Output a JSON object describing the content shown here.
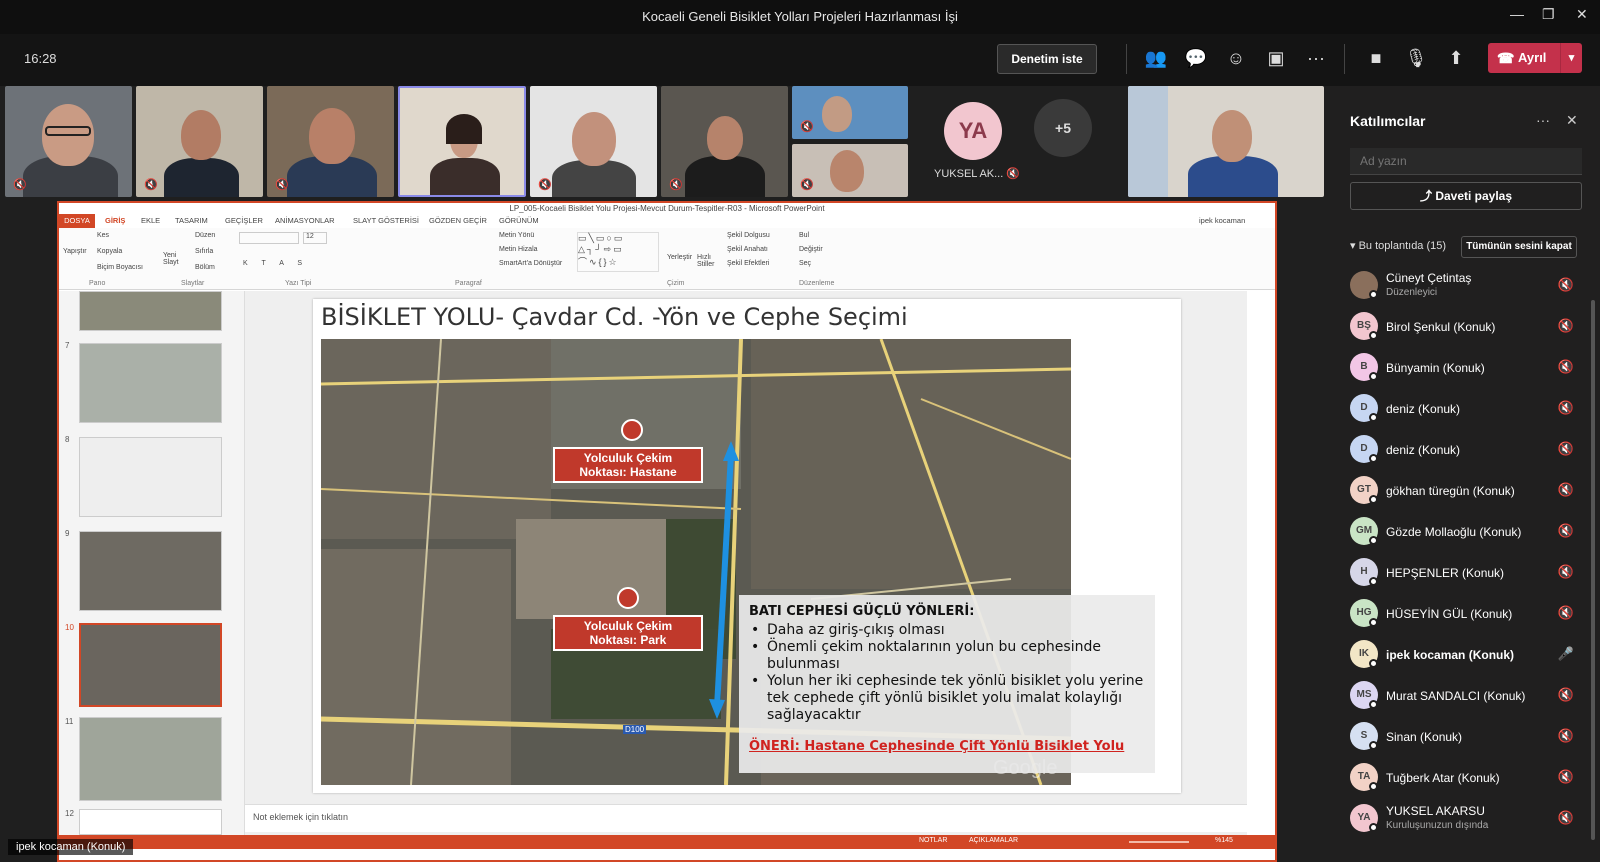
{
  "window": {
    "title": "Kocaeli Geneli Bisiklet Yolları Projeleri Hazırlanması İşi"
  },
  "toolbar": {
    "time": "16:28",
    "request_control_label": "Denetim iste",
    "leave_label": "Ayrıl",
    "icons": [
      "people-icon",
      "chat-icon",
      "reactions-icon",
      "rooms-icon",
      "more-icon",
      "camera-icon",
      "mic-off-icon",
      "share-icon"
    ]
  },
  "videos": {
    "avatar_initials": "YA",
    "avatar_name": "YUKSEL AK...",
    "overflow_count": "+5"
  },
  "participants_panel": {
    "title": "Katılımcılar",
    "search_placeholder": "Ad yazın",
    "share_invite_label": "Daveti paylaş",
    "section_header": "Bu toplantıda (15)",
    "mute_all_label": "Tümünün sesini kapat",
    "people": [
      {
        "initials": "",
        "name": "Cüneyt Çetintaş",
        "subtitle": "Düzenleyici",
        "avatar_color": "#8a6f5c",
        "mic": "off"
      },
      {
        "initials": "BŞ",
        "name": "Birol Şenkul (Konuk)",
        "subtitle": "",
        "avatar_color": "#f2c6cf",
        "mic": "off"
      },
      {
        "initials": "B",
        "name": "Bünyamin (Konuk)",
        "subtitle": "",
        "avatar_color": "#f2c6e6",
        "mic": "off"
      },
      {
        "initials": "D",
        "name": "deniz (Konuk)",
        "subtitle": "",
        "avatar_color": "#c6d6f2",
        "mic": "off"
      },
      {
        "initials": "D",
        "name": "deniz (Konuk)",
        "subtitle": "",
        "avatar_color": "#c6d6f2",
        "mic": "off"
      },
      {
        "initials": "GT",
        "name": "gökhan türegün (Konuk)",
        "subtitle": "",
        "avatar_color": "#f2d2c6",
        "mic": "off"
      },
      {
        "initials": "GM",
        "name": "Gözde Mollaoğlu (Konuk)",
        "subtitle": "",
        "avatar_color": "#c9e4c5",
        "mic": "off"
      },
      {
        "initials": "H",
        "name": "HEPŞENLER (Konuk)",
        "subtitle": "",
        "avatar_color": "#d6d6e8",
        "mic": "off"
      },
      {
        "initials": "HG",
        "name": "HÜSEYİN GÜL (Konuk)",
        "subtitle": "",
        "avatar_color": "#c9e4c5",
        "mic": "off"
      },
      {
        "initials": "IK",
        "name": "ipek kocaman (Konuk)",
        "subtitle": "",
        "avatar_color": "#f2e6c6",
        "mic": "on"
      },
      {
        "initials": "MS",
        "name": "Murat SANDALCI (Konuk)",
        "subtitle": "",
        "avatar_color": "#dcd6f2",
        "mic": "off"
      },
      {
        "initials": "S",
        "name": "Sinan (Konuk)",
        "subtitle": "",
        "avatar_color": "#d6e0f2",
        "mic": "off"
      },
      {
        "initials": "TA",
        "name": "Tuğberk Atar (Konuk)",
        "subtitle": "",
        "avatar_color": "#f2d2c6",
        "mic": "off"
      },
      {
        "initials": "YA",
        "name": "YUKSEL AKARSU",
        "subtitle": "Kuruluşunuzun dışında",
        "avatar_color": "#f2c6cf",
        "mic": "off"
      }
    ]
  },
  "powerpoint": {
    "title": "LP_005-Kocaeli Bisiklet Yolu Projesi-Mevcut Durum-Tespitler-R03 - Microsoft PowerPoint",
    "tabs": [
      "DOSYA",
      "GİRİŞ",
      "EKLE",
      "TASARIM",
      "GEÇİŞLER",
      "ANİMASYONLAR",
      "SLAYT GÖSTERİSİ",
      "GÖZDEN GEÇİR",
      "GÖRÜNÜM"
    ],
    "user": "ipek kocaman",
    "ribbon": {
      "paste": "Yapıştır",
      "cut": "Kes",
      "copy": "Kopyala",
      "format_painter": "Biçim Boyacısı",
      "new_slide": "Yeni Slayt",
      "layout": "Düzen",
      "reset": "Sıfırla",
      "section": "Bölüm",
      "font_size": "12",
      "text_direction": "Metin Yönü",
      "align_text": "Metin Hizala",
      "smartart": "SmartArt'a Dönüştür",
      "arrange": "Yerleştir",
      "quick_styles": "Hızlı Stiller",
      "shape_fill": "Şekil Dolgusu",
      "shape_outline": "Şekil Anahatı",
      "shape_effects": "Şekil Efektleri",
      "find": "Bul",
      "replace": "Değiştir",
      "select": "Seç",
      "group_clipboard": "Pano",
      "group_slides": "Slaytlar",
      "group_font": "Yazı Tipi",
      "group_paragraph": "Paragraf",
      "group_drawing": "Çizim",
      "group_editing": "Düzenleme"
    },
    "thumbnails": [
      "7",
      "8",
      "9",
      "10",
      "11",
      "12"
    ],
    "notes_placeholder": "Not eklemek için tıklatın",
    "status": {
      "notes": "NOTLAR",
      "comments": "AÇIKLAMALAR",
      "zoom": "%145"
    }
  },
  "slide": {
    "heading": "BİSİKLET YOLU- Çavdar Cd. -Yön ve Cephe Seçimi",
    "label_hospital": "Yolculuk Çekim Noktası: Hastane",
    "label_park": "Yolculuk Çekim Noktası: Park",
    "strengths_title": "BATI CEPHESİ GÜÇLÜ YÖNLERİ:",
    "bullets": [
      "Daha az giriş-çıkış olması",
      "Önemli çekim noktalarının yolun bu cephesinde bulunması",
      "Yolun her iki cephesinde tek yönlü bisiklet yolu yerine tek cephede çift yönlü bisiklet yolu imalat kolaylığı sağlayacaktır"
    ],
    "recommendation": "ÖNERİ: Hastane Cephesinde Çift Yönlü Bisiklet Yolu",
    "map_watermark": "Google",
    "road_badge": "D100"
  },
  "self_view": {
    "name": "ipek kocaman (Konuk)"
  }
}
